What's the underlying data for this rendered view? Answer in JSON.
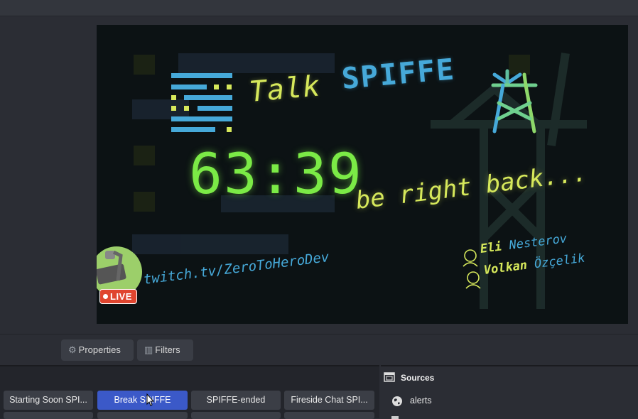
{
  "overlay": {
    "logo_talk": "Talk",
    "logo_spiffe": "SPIFFE",
    "timer": "63:39",
    "brb": "be right back...",
    "twitch_url": "twitch.tv/ZeroToHeroDev",
    "live_badge": "LIVE",
    "presenters": [
      {
        "first": "Eli",
        "last": "Nesterov"
      },
      {
        "first": "Volkan",
        "last": "Özçelik"
      }
    ]
  },
  "toolbar": {
    "properties_label": "Properties",
    "filters_label": "Filters"
  },
  "scenes": {
    "row1": [
      "Starting Soon SPI...",
      "Break SPIFFE",
      "SPIFFE-ended",
      "Fireside Chat SPI..."
    ],
    "active_index": 1
  },
  "sources": {
    "title": "Sources",
    "items": [
      {
        "label": "alerts",
        "icon": "globe-icon"
      }
    ]
  },
  "colors": {
    "timer": "#7bea46",
    "accent_yellow": "#d6e85b",
    "accent_blue": "#46a9d9",
    "active_scene": "#3b59c8",
    "live_badge": "#e0452f"
  }
}
